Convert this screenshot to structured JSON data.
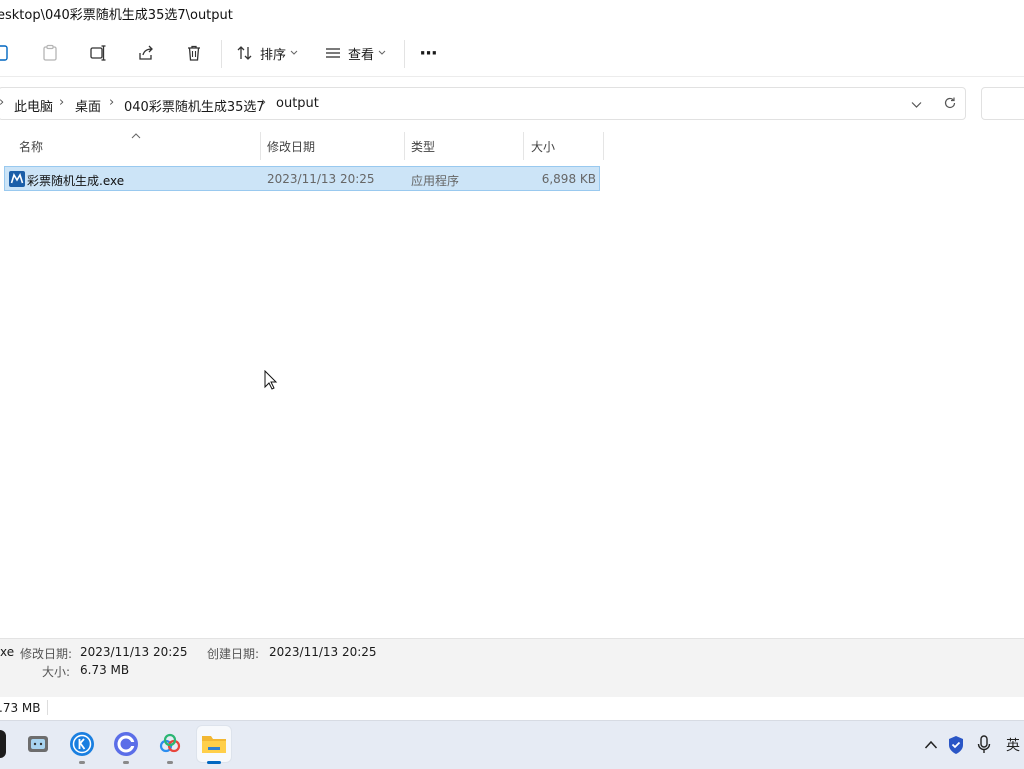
{
  "window": {
    "title_path": "esktop\\040彩票随机生成35选7\\output"
  },
  "toolbar": {
    "sort_label": "排序",
    "view_label": "查看",
    "more_label": "···"
  },
  "address": {
    "crumbs": [
      "此电脑",
      "桌面",
      "040彩票随机生成35选7",
      "output"
    ]
  },
  "columns": {
    "name": "名称",
    "modified": "修改日期",
    "type": "类型",
    "size": "大小"
  },
  "files": [
    {
      "name": "彩票随机生成.exe",
      "modified": "2023/11/13 20:25",
      "type": "应用程序",
      "size": "6,898 KB",
      "selected": true
    }
  ],
  "details": {
    "name_tail": "xe",
    "modified_label": "修改日期:",
    "modified_value": "2023/11/13 20:25",
    "created_label": "创建日期:",
    "created_value": "2023/11/13 20:25",
    "size_label": "大小:",
    "size_value": "6.73 MB"
  },
  "status": {
    "text": ".73 MB"
  },
  "taskbar": {
    "ime_label": "英"
  },
  "colors": {
    "accent": "#0067c0",
    "selection": "#cce4f7",
    "selection_border": "#99c9ef"
  }
}
